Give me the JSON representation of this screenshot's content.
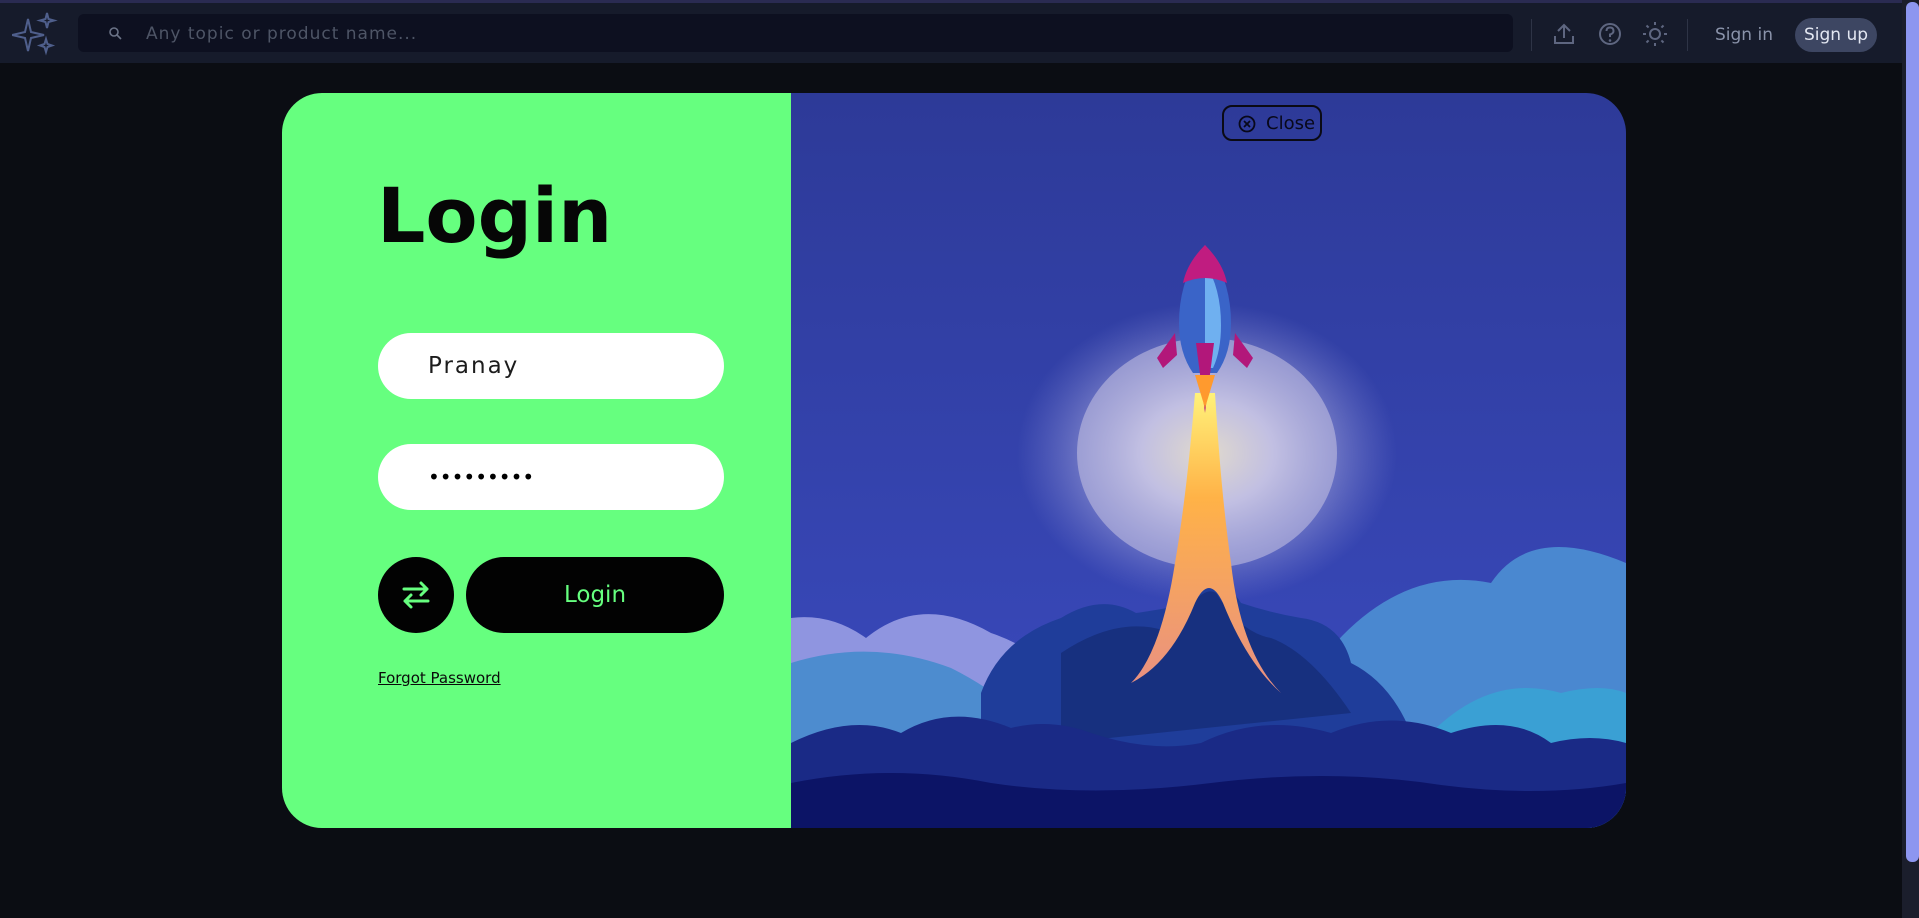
{
  "topbar": {
    "search_placeholder": "Any topic or product name...",
    "sign_in": "Sign in",
    "sign_up": "Sign up"
  },
  "icons": [
    "sparkle-logo-icon",
    "search-icon",
    "upload-icon",
    "help-icon",
    "theme-sun-icon",
    "close-icon",
    "swap-arrows-icon"
  ],
  "modal": {
    "title": "Login",
    "username_value": "Pranay",
    "password_masked": "•••••••••",
    "login_button": "Login",
    "forgot_password": "Forgot Password",
    "close_label": "Close"
  },
  "colors": {
    "accent_green": "#66ff7f",
    "page_bg": "#0b0d13",
    "topbar_bg": "#161b2b",
    "illustration_sky": "#2f3ea8"
  }
}
